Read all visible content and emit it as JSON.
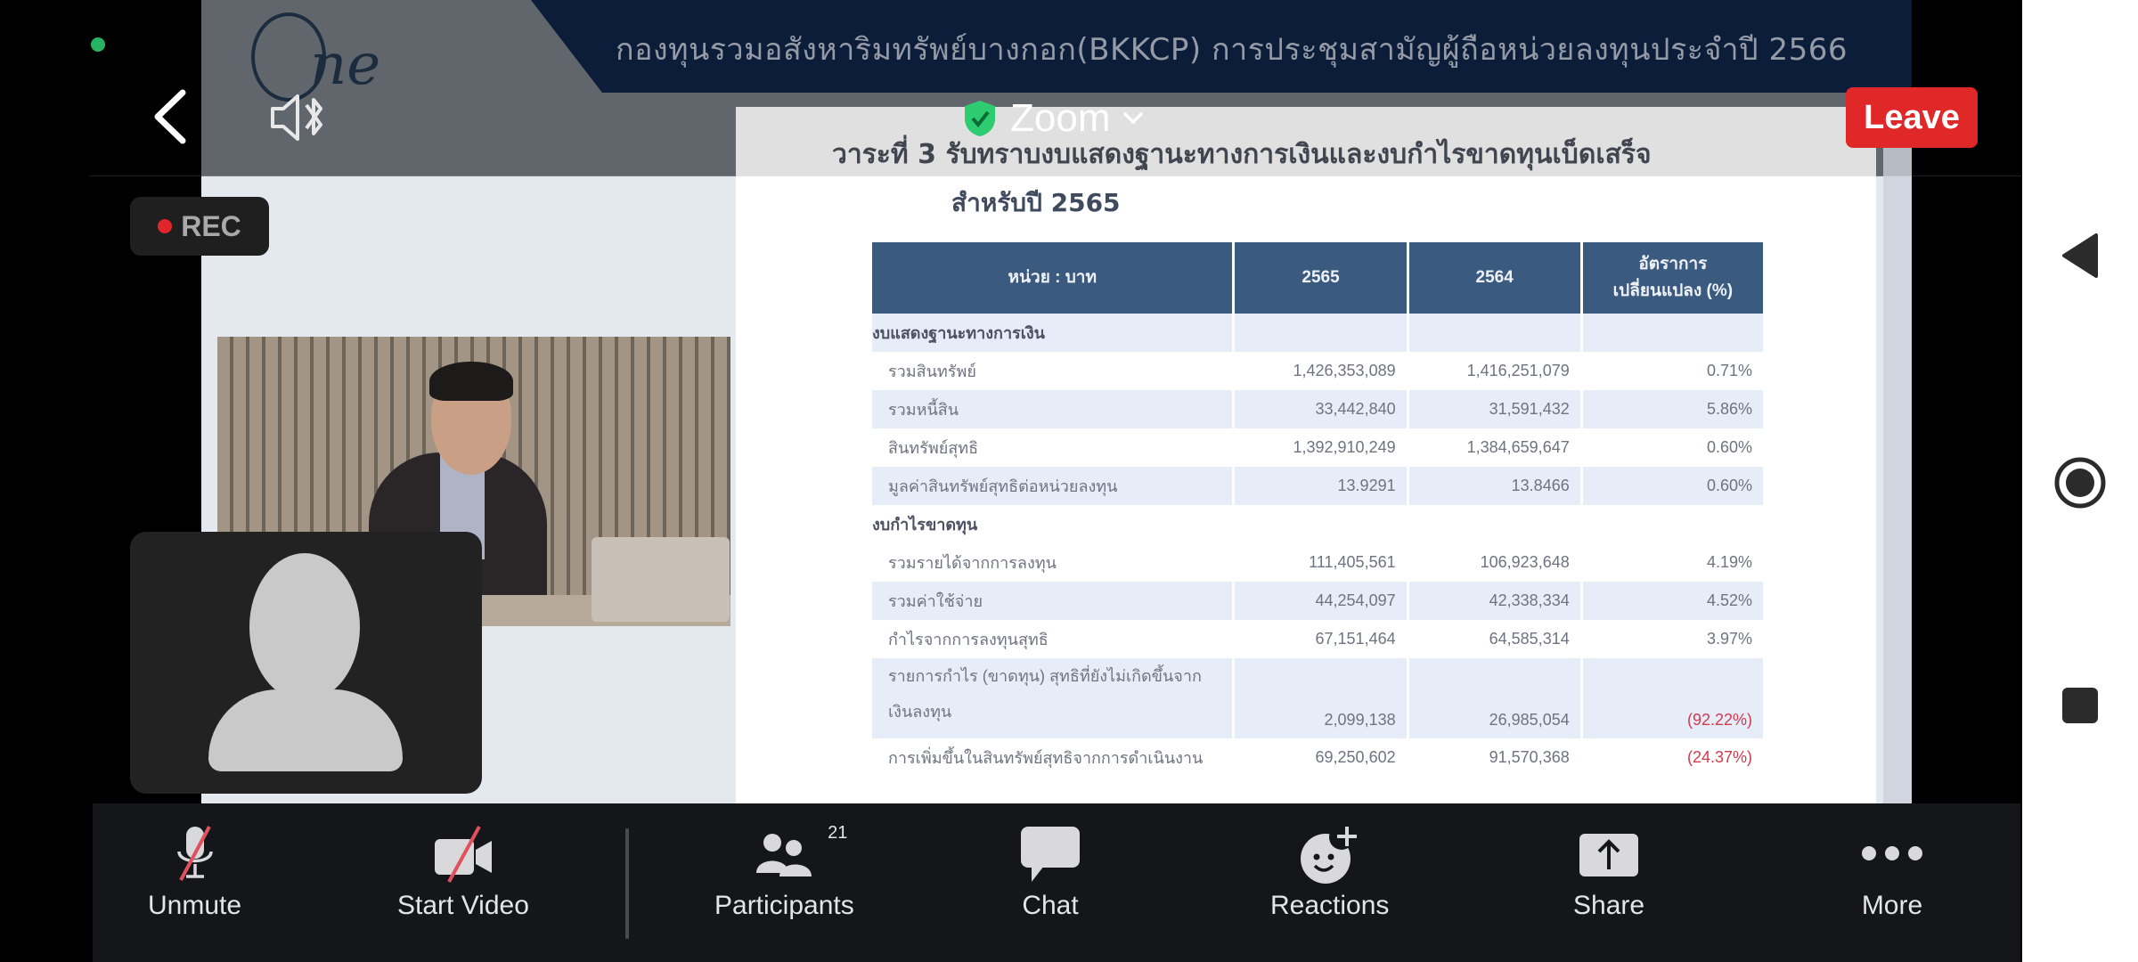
{
  "app": {
    "meeting_title": "Zoom",
    "leave_label": "Leave",
    "rec_label": "REC",
    "colors": {
      "leave": "#e02828",
      "secure_shield": "#2ecc71",
      "rec_dot": "#e0252b",
      "mute_slash": "#e0505f"
    }
  },
  "slide": {
    "banner": "กองทุนรวมอสังหาริมทรัพย์บางกอก(BKKCP) การประชุมสามัญผู้ถือหน่วยลงทุนประจำปี 2566",
    "title": "วาระที่ 3  รับทราบงบแสดงฐานะทางการเงินและงบกำไรขาดทุนเบ็ดเสร็จ",
    "subtitle": "สำหรับปี 2565",
    "table": {
      "headers": [
        "หน่วย : บาท",
        "2565",
        "2564",
        "อัตราการ\nเปลี่ยนแปลง (%)"
      ],
      "header_line1": "อัตราการ",
      "header_line2": "เปลี่ยนแปลง (%)",
      "rows": [
        {
          "type": "section",
          "label": "งบแสดงฐานะทางการเงิน"
        },
        {
          "type": "row",
          "label": "รวมสินทรัพย์",
          "y2565": "1,426,353,089",
          "y2564": "1,416,251,079",
          "change": "0.71%"
        },
        {
          "type": "row",
          "label": "รวมหนี้สิน",
          "y2565": "33,442,840",
          "y2564": "31,591,432",
          "change": "5.86%"
        },
        {
          "type": "row",
          "label": "สินทรัพย์สุทธิ",
          "y2565": "1,392,910,249",
          "y2564": "1,384,659,647",
          "change": "0.60%"
        },
        {
          "type": "row",
          "label": "มูลค่าสินทรัพย์สุทธิต่อหน่วยลงทุน",
          "y2565": "13.9291",
          "y2564": "13.8466",
          "change": "0.60%"
        },
        {
          "type": "section",
          "label": "งบกำไรขาดทุน"
        },
        {
          "type": "row",
          "label": "รวมรายได้จากการลงทุน",
          "y2565": "111,405,561",
          "y2564": "106,923,648",
          "change": "4.19%"
        },
        {
          "type": "row",
          "label": "รวมค่าใช้จ่าย",
          "y2565": "44,254,097",
          "y2564": "42,338,334",
          "change": "4.52%"
        },
        {
          "type": "row",
          "label": "กำไรจากการลงทุนสุทธิ",
          "y2565": "67,151,464",
          "y2564": "64,585,314",
          "change": "3.97%"
        },
        {
          "type": "row",
          "label": "รายการกำไร (ขาดทุน) สุทธิที่ยังไม่เกิดขึ้นจากเงินลงทุน",
          "label_line1": "รายการกำไร (ขาดทุน) สุทธิที่ยังไม่เกิดขึ้นจาก",
          "label_line2": "เงินลงทุน",
          "y2565": "2,099,138",
          "y2564": "26,985,054",
          "change": "(92.22%)"
        },
        {
          "type": "row",
          "label": "การเพิ่มขึ้นในสินทรัพย์สุทธิจากการดำเนินงาน",
          "y2565": "69,250,602",
          "y2564": "91,570,368",
          "change": "(24.37%)"
        }
      ]
    }
  },
  "toolbar": {
    "unmute": "Unmute",
    "start_video": "Start Video",
    "participants": "Participants",
    "participants_count": "21",
    "chat": "Chat",
    "reactions": "Reactions",
    "share": "Share",
    "more": "More"
  },
  "icons": {
    "back": "chevron-left-icon",
    "speaker": "speaker-muted-bluetooth-icon",
    "shield": "shield-check-icon",
    "nav_back": "triangle-back-icon",
    "nav_home": "circle-home-icon",
    "nav_recents": "square-recents-icon"
  }
}
